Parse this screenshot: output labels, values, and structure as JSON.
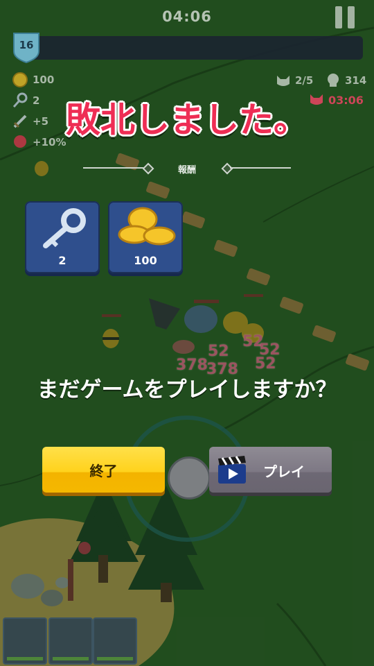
{
  "hud": {
    "timer": "04:06",
    "level": "16",
    "coins": "100",
    "keys": "2",
    "attack_bonus": "+5",
    "power_bonus": "+10%",
    "enemy_progress": "2/5",
    "kills": "314",
    "boss_timer": "03:06",
    "pause_icon": "pause-icon"
  },
  "defeat": {
    "title": "敗北しました。",
    "reward_label": "報酬"
  },
  "rewards": [
    {
      "icon": "key-icon",
      "value": "2"
    },
    {
      "icon": "coin-stack-icon",
      "value": "100"
    }
  ],
  "damage_numbers": [
    "52",
    "52",
    "52",
    "52",
    "378",
    "378"
  ],
  "dialog": {
    "question": "まだゲームをプレイしますか？",
    "end_button": "終了",
    "play_button": "プレイ",
    "play_icon": "video-clapper-icon"
  },
  "colors": {
    "title": "#ee2d54",
    "end_button": "#ffd21c",
    "play_button": "#7d7884",
    "reward_card": "#2f4f8d",
    "boss_timer": "#e0455f"
  }
}
